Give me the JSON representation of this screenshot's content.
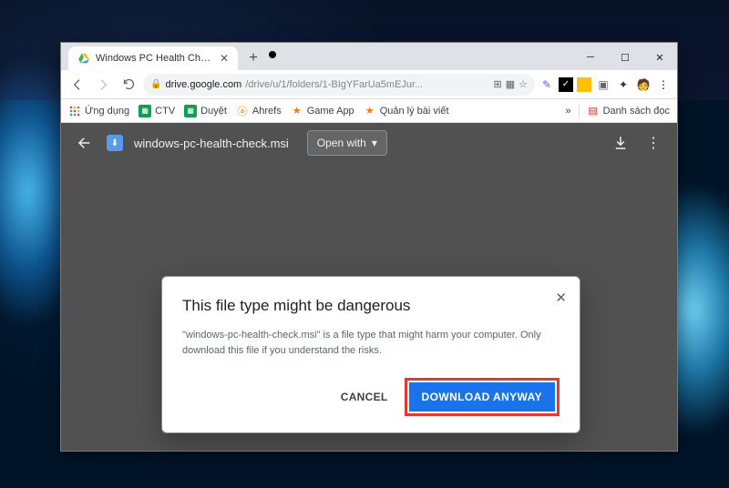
{
  "tab": {
    "title": "Windows PC Health Check - Goo"
  },
  "url": {
    "site": "drive.google.com",
    "path": "/drive/u/1/folders/1-BIgYFarUa5mEJur..."
  },
  "bookmarks": {
    "apps": "Ứng dụng",
    "items": [
      "CTV",
      "Duyệt",
      "Ahrefs",
      "Game App",
      "Quản lý bài viết"
    ],
    "reading_list": "Danh sách đọc"
  },
  "viewer": {
    "filename": "windows-pc-health-check.msi",
    "open_with": "Open with"
  },
  "dialog": {
    "title": "This file type might be dangerous",
    "body": "\"windows-pc-health-check.msi\" is a file type that might harm your computer. Only download this file if you understand the risks.",
    "cancel": "CANCEL",
    "confirm": "DOWNLOAD ANYWAY"
  }
}
